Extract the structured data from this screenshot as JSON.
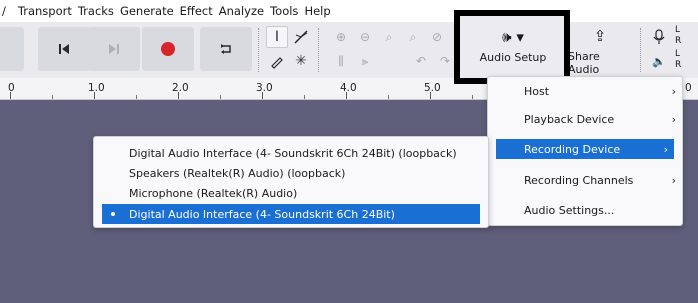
{
  "menubar": {
    "items": [
      "/",
      "Transport",
      "Tracks",
      "Generate",
      "Effect",
      "Analyze",
      "Tools",
      "Help"
    ]
  },
  "toolbar": {
    "audio_setup_label": "Audio Setup",
    "share_audio_label": "Share Audio",
    "meter_labels": [
      "L",
      "R",
      "L",
      "R"
    ],
    "icons": {
      "skip_start": "skip-to-start-icon",
      "skip_end": "skip-to-end-icon",
      "record": "record-icon",
      "loop": "loop-icon",
      "select_tool": "selection-tool-icon",
      "envelope_tool": "envelope-tool-icon",
      "draw_tool": "draw-tool-icon",
      "multi_tool": "multi-tool-icon",
      "speaker": "speaker-icon",
      "share": "share-icon",
      "microphone": "microphone-icon"
    },
    "colors": {
      "record": "#d7262a"
    }
  },
  "ruler": {
    "labels": [
      "0",
      "1.0",
      "2.0",
      "3.0",
      "4.0",
      "5.0",
      "0"
    ]
  },
  "audio_setup_menu": {
    "items": [
      {
        "label": "Host",
        "has_submenu": true,
        "selected": false
      },
      {
        "label": "Playback Device",
        "has_submenu": true,
        "selected": false
      },
      {
        "label": "Recording Device",
        "has_submenu": true,
        "selected": true
      },
      {
        "label": "Recording Channels",
        "has_submenu": true,
        "selected": false
      },
      {
        "label": "Audio Settings...",
        "has_submenu": false,
        "selected": false
      }
    ]
  },
  "recording_device_menu": {
    "items": [
      {
        "label": "Digital Audio Interface (4- Soundskrit 6Ch 24Bit) (loopback)",
        "selected": false
      },
      {
        "label": "Speakers (Realtek(R) Audio) (loopback)",
        "selected": false
      },
      {
        "label": "Microphone (Realtek(R) Audio)",
        "selected": false
      },
      {
        "label": "Digital Audio Interface (4- Soundskrit 6Ch 24Bit)",
        "selected": true
      }
    ]
  },
  "colors": {
    "track_area": "#5f5f7c",
    "menu_selection": "#1a6fd4",
    "highlight_box": "#000000"
  }
}
